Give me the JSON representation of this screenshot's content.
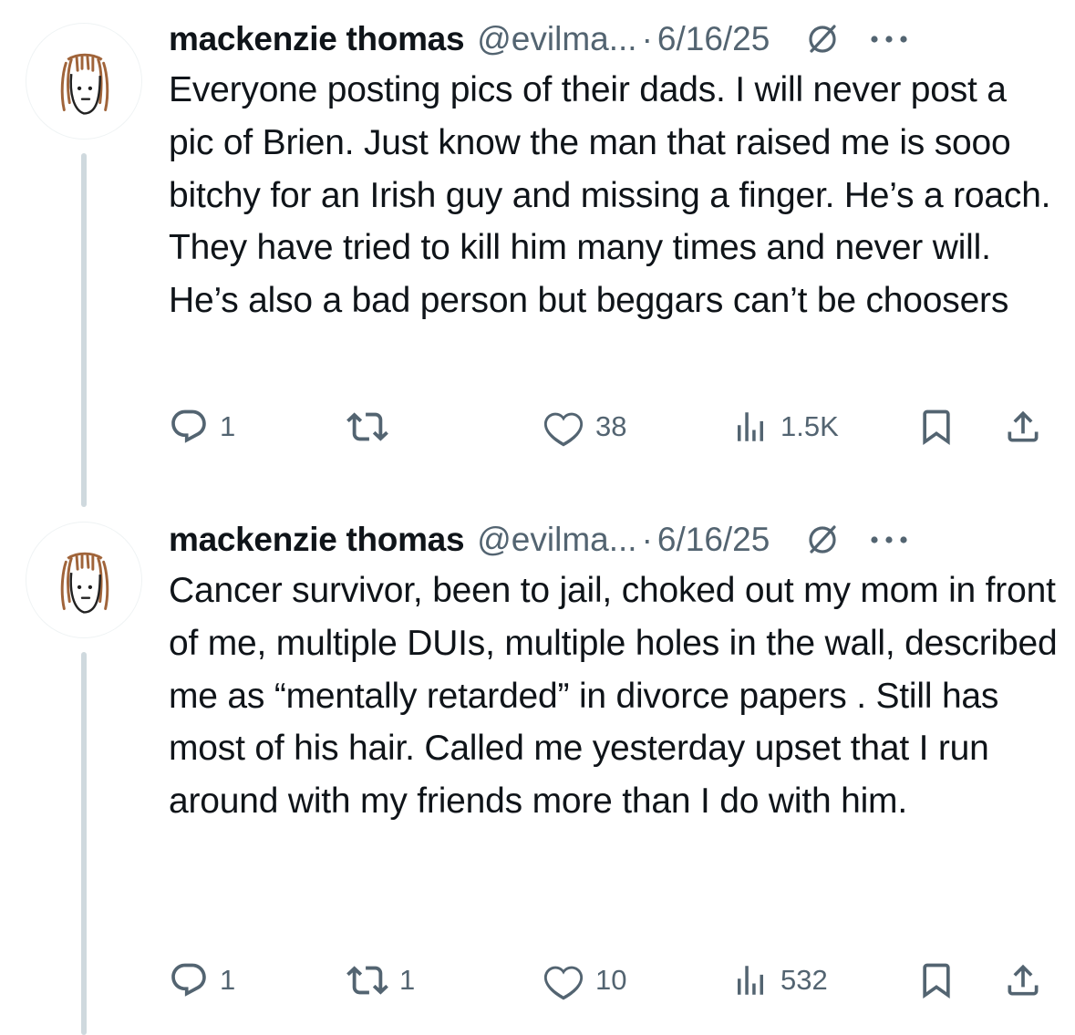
{
  "tweets": [
    {
      "display_name": "mackenzie thomas",
      "handle": "@evilma...",
      "separator": "·",
      "date": "6/16/25",
      "text": "Everyone posting pics of their dads. I will never post a pic of Brien. Just know the man that raised me is sooo bitchy for an Irish guy and missing a finger. He’s a roach. They have tried to kill him many times and never will. He’s also a bad person but beggars can’t be choosers",
      "replies": "1",
      "reposts": "",
      "likes": "38",
      "views": "1.5K"
    },
    {
      "display_name": "mackenzie thomas",
      "handle": "@evilma...",
      "separator": "·",
      "date": "6/16/25",
      "text": "Cancer survivor, been to jail, choked out my mom in front of me, multiple DUIs, multiple holes in the wall, described me as “mentally retarded” in divorce papers . Still has most of his hair. Called me yesterday upset that I run around with my friends more than I do with him.",
      "replies": "1",
      "reposts": "1",
      "likes": "10",
      "views": "532"
    }
  ],
  "icons": {
    "reply": "reply-icon",
    "repost": "repost-icon",
    "like": "heart-icon",
    "views": "views-icon",
    "bookmark": "bookmark-icon",
    "share": "share-icon",
    "grok": "grok-icon",
    "more": "more-icon"
  },
  "colors": {
    "text": "#0f1419",
    "secondary": "#536471",
    "thread_line": "#cfd9de",
    "avatar_hair": "#a0643a"
  }
}
